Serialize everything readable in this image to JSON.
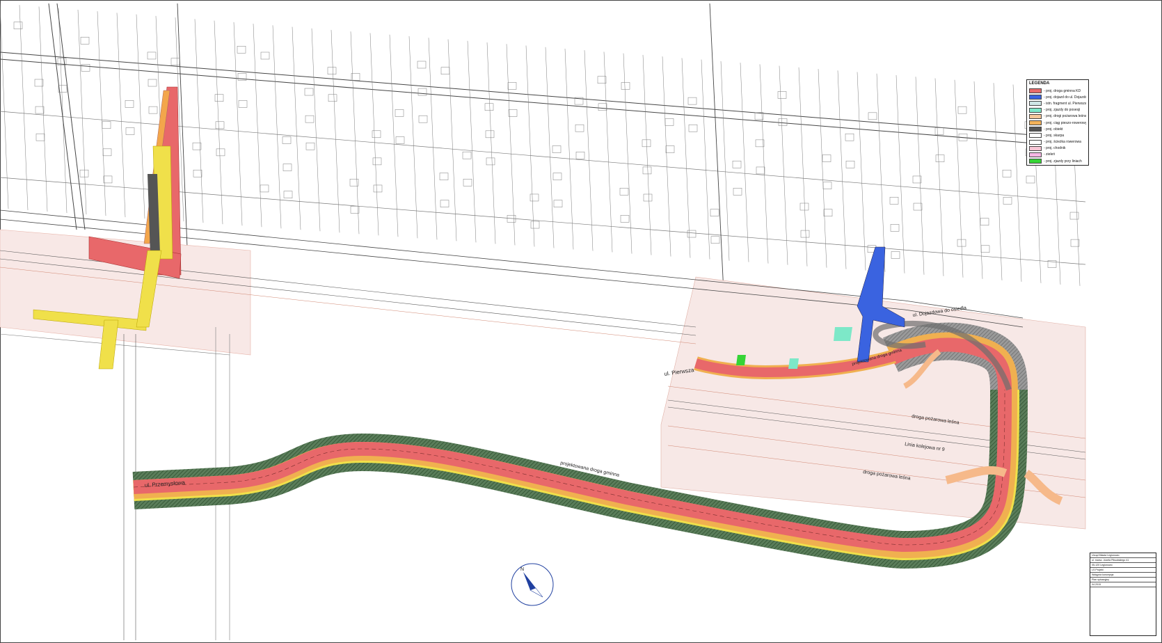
{
  "legend": {
    "title": "LEGENDA",
    "items": [
      {
        "label": "- proj. droga gminna KD",
        "color": "#e86a6a"
      },
      {
        "label": "- proj. dojazd do ul. Dojazdowa do osiedla",
        "color": "#3a63e0"
      },
      {
        "label": "- istn. fragment ul. Pierwsza",
        "color": "#cfe6e6"
      },
      {
        "label": "- proj. zjazdy do posesji",
        "color": "#7de8c8"
      },
      {
        "label": "- proj. drogi pożarowa leśna",
        "color": "#f6c89a"
      },
      {
        "label": "- proj. ciąg pieszo-rowerowy",
        "color": "#f3b25a"
      },
      {
        "label": "- proj. obiekt",
        "color": "#555555"
      },
      {
        "label": "- proj. skarpa",
        "color": "#ffffff"
      },
      {
        "label": "- proj. ścieżka rowerowa",
        "color": "#ffffff"
      },
      {
        "label": "- proj. chodnik",
        "color": "#f8c6d6"
      },
      {
        "label": "- zieleń",
        "color": "#f7b6e4"
      },
      {
        "label": "- proj. zjazdy przy liniach",
        "color": "#36d436"
      }
    ]
  },
  "colors": {
    "road_red": "#e8686a",
    "sidewalk_orange": "#f0b050",
    "cycle_yellow": "#f0e04a",
    "green_verge": "#3d7a3d",
    "blue_access": "#3a63e0",
    "rail_zone_pink": "#f7e4e4"
  },
  "labels": {
    "ul_pierwsza": "ul. Pierwsza",
    "ul_przemyslowa": "ul. Przemysłowa",
    "ul_dojazdowa": "ul. Dojazdowa do osiedla",
    "projektowana_droga_1": "projektowana droga gminna",
    "projektowana_droga_2": "projektowana droga gminna",
    "droga_pozarowa_1": "droga pożarowa leśna",
    "droga_pozarowa_2": "droga pożarowa leśna",
    "linia_kolejowa": "Linia kolejowa nr 9"
  },
  "title_block": {
    "office": "Urząd Miasta Legionowo",
    "address": "ul. marsz. Józefa Piłsudskiego 41",
    "city": "05-120 Legionowo",
    "firm": "LS Projekt",
    "sheet_title": "Wstępna koncepcja",
    "drawing": "Plan sytuacyjny",
    "date": "04.2015"
  },
  "north_arrow": "N"
}
